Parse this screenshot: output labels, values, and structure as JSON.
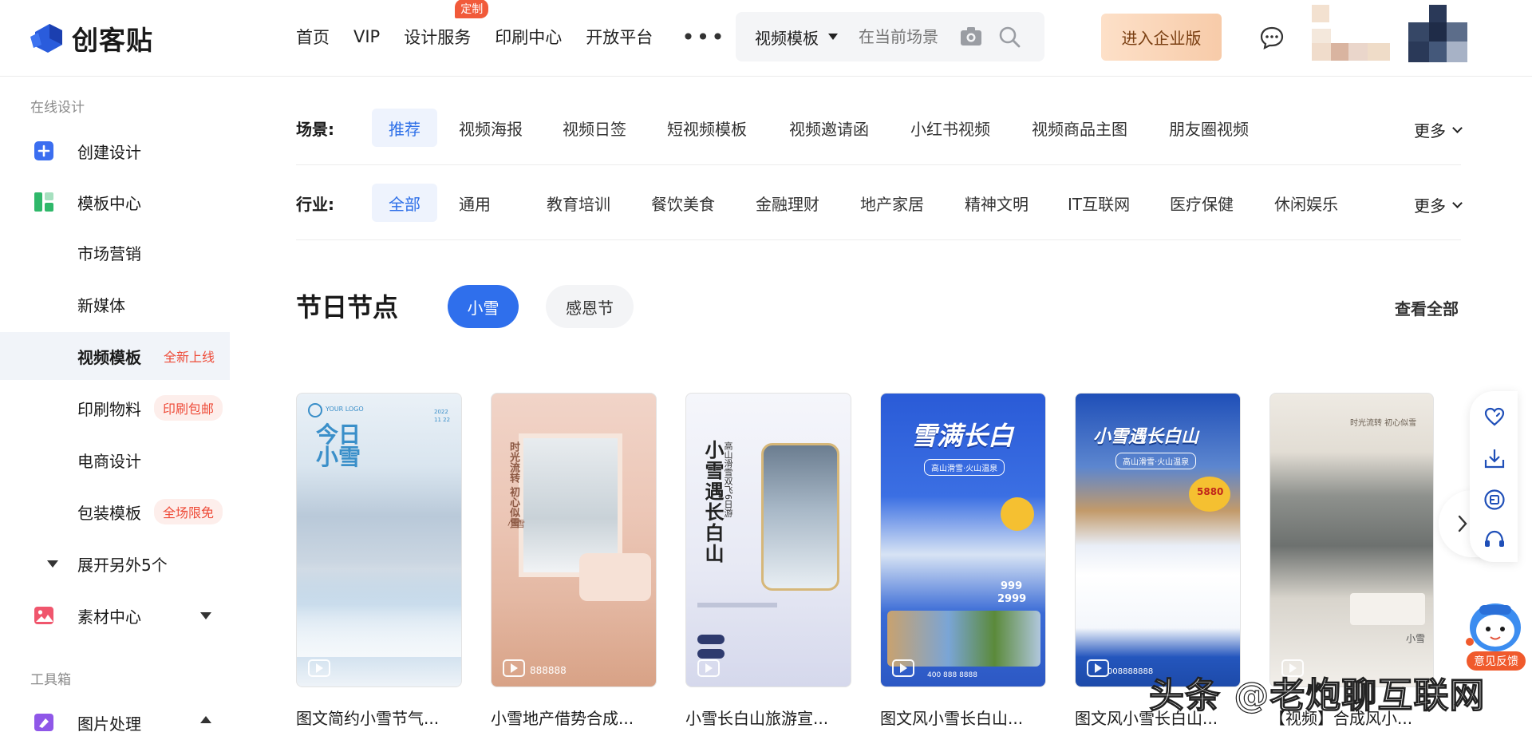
{
  "brand": {
    "name": "创客贴"
  },
  "nav": {
    "items": [
      {
        "label": "首页"
      },
      {
        "label": "VIP"
      },
      {
        "label": "设计服务",
        "badge": "定制"
      },
      {
        "label": "印刷中心"
      },
      {
        "label": "开放平台"
      }
    ],
    "more": "•••"
  },
  "search": {
    "type": "视频模板",
    "placeholder": "在当前场景"
  },
  "header": {
    "enterprise_label": "进入企业版"
  },
  "sidebar": {
    "section_online": "在线设计",
    "section_tools": "工具箱",
    "items": [
      {
        "label": "创建设计"
      },
      {
        "label": "模板中心"
      },
      {
        "label": "市场营销"
      },
      {
        "label": "新媒体"
      },
      {
        "label": "视频模板",
        "tag": "全新上线"
      },
      {
        "label": "印刷物料",
        "tag": "印刷包邮"
      },
      {
        "label": "电商设计"
      },
      {
        "label": "包装模板",
        "tag": "全场限免"
      },
      {
        "label": "展开另外5个"
      },
      {
        "label": "素材中心"
      },
      {
        "label": "图片处理"
      }
    ]
  },
  "filters": {
    "scene": {
      "title": "场景:",
      "options": [
        "推荐",
        "视频海报",
        "视频日签",
        "短视频模板",
        "视频邀请函",
        "小红书视频",
        "视频商品主图",
        "朋友圈视频"
      ],
      "selected": "推荐",
      "more": "更多"
    },
    "industry": {
      "title": "行业:",
      "options": [
        "全部",
        "通用",
        "教育培训",
        "餐饮美食",
        "金融理财",
        "地产家居",
        "精神文明",
        "IT互联网",
        "医疗保健",
        "休闲娱乐"
      ],
      "selected": "全部",
      "more": "更多"
    }
  },
  "festival": {
    "title": "节日节点",
    "tabs": [
      "小雪",
      "感恩节"
    ],
    "active_tab": "小雪",
    "view_all": "查看全部"
  },
  "cards": [
    {
      "caption": "图文简约小雪节气...",
      "poster_title": "今日小雪",
      "logo": "YOUR LOGO",
      "date": "2022 11 22"
    },
    {
      "caption": "小雪地产借势合成...",
      "poster_title": "小雪",
      "poster_sub": "时光流转 初心似雪",
      "phone": "888888"
    },
    {
      "caption": "小雪长白山旅游宣...",
      "poster_title": "小雪遇长白山",
      "poster_sub": "高山滑雪双飞6日游"
    },
    {
      "caption": "图文风小雪长白山...",
      "poster_title": "雪满长白",
      "poster_sub": "高山滑雪·火山温泉",
      "price_1": "999",
      "price_2": "2999",
      "phone": "400 888 8888"
    },
    {
      "caption": "图文风小雪长白山...",
      "poster_title": "小雪遇长白山",
      "poster_sub": "高山滑雪·火山温泉",
      "price": "5880",
      "phone": "008888888"
    },
    {
      "caption": "【视频】合成风小...",
      "poster_title": "时光流转 初心似雪",
      "poster_sub": "小雪"
    }
  ],
  "feedback": {
    "label": "意见反馈"
  },
  "watermark": "头条 @老炮聊互联网",
  "colors": {
    "accent": "#2f6fec",
    "tag_red": "#ee4b38",
    "enterprise_bg": "#f7cba9"
  }
}
